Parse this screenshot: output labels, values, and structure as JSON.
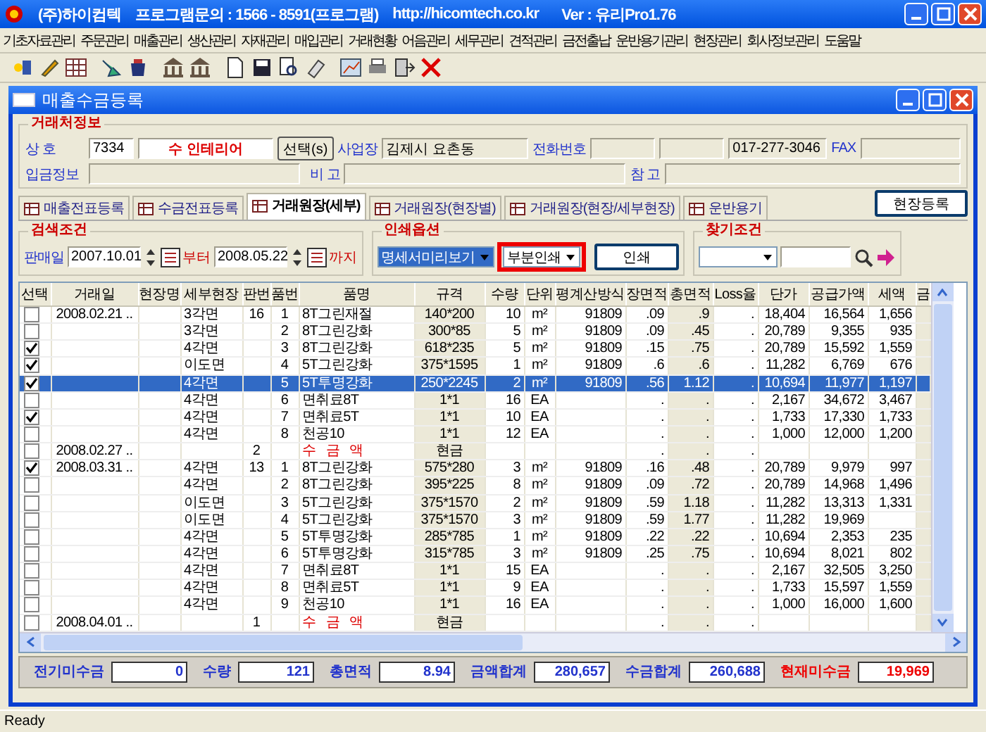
{
  "app": {
    "title": "(주)하이컴텍",
    "contact": "프로그램문의 : 1566 - 8591(프로그램)",
    "url": "http://hicomtech.co.kr",
    "version": "Ver : 유리Pro1.76"
  },
  "menu": [
    "기초자료관리",
    "주문관리",
    "매출관리",
    "생산관리",
    "자재관리",
    "매입관리",
    "거래현황",
    "어음관리",
    "세무관리",
    "견적관리",
    "금전출납",
    "운반용기관리",
    "현장관리",
    "회사정보관리",
    "도움말"
  ],
  "window": {
    "title": "매출수금등록"
  },
  "client_info": {
    "group": "거래처정보",
    "name_label": "상 호",
    "code": "7334",
    "name": "수 인테리어",
    "select_button": "선택(s)",
    "site_label": "사업장",
    "site": "김제시 요촌동",
    "phone_label": "전화번호",
    "phone": "017-277-3046",
    "fax_label": "FAX",
    "deposit_label": "입금정보",
    "memo_label": "비 고",
    "note_label": "참 고"
  },
  "tabs": [
    {
      "label": "매출전표등록",
      "selected": false
    },
    {
      "label": "수금전표등록",
      "selected": false
    },
    {
      "label": "거래원장(세부)",
      "selected": true
    },
    {
      "label": "거래원장(현장별)",
      "selected": false
    },
    {
      "label": "거래원장(현장/세부현장)",
      "selected": false
    },
    {
      "label": "운반용기",
      "selected": false
    }
  ],
  "site_button": "현장등록",
  "search": {
    "group": "검색조건",
    "date_label": "판매일",
    "from": "2007.10.01",
    "from_suffix": "부터",
    "to": "2008.05.22",
    "to_suffix": "까지"
  },
  "print": {
    "group": "인쇄옵션",
    "mode": "명세서미리보기",
    "range": "부분인쇄",
    "button": "인쇄"
  },
  "find": {
    "group": "찾기조건"
  },
  "table": {
    "columns": [
      "선택",
      "거래일",
      "현장명",
      "세부현장",
      "판번",
      "품번",
      "품명",
      "규격",
      "수량",
      "단위",
      "평계산방식",
      "장면적",
      "총면적",
      "Loss율",
      "단가",
      "공급가액",
      "세액",
      "금"
    ],
    "rows": [
      {
        "kind": "item",
        "checked": false,
        "selected": false,
        "cells": [
          null,
          "2008.02.21 ..",
          null,
          "3각면",
          "16",
          "1",
          "8T그린재절",
          "140*200",
          "10",
          "m²",
          "91809",
          ".09",
          ".9",
          ".",
          "18,404",
          "16,564",
          "1,656"
        ]
      },
      {
        "kind": "item",
        "checked": false,
        "selected": false,
        "cells": [
          null,
          null,
          null,
          "3각면",
          null,
          "2",
          "8T그린강화",
          "300*85",
          "5",
          "m²",
          "91809",
          ".09",
          ".45",
          ".",
          "20,789",
          "9,355",
          "935"
        ]
      },
      {
        "kind": "item",
        "checked": true,
        "selected": false,
        "cells": [
          null,
          null,
          null,
          "4각면",
          null,
          "3",
          "8T그린강화",
          "618*235",
          "5",
          "m²",
          "91809",
          ".15",
          ".75",
          ".",
          "20,789",
          "15,592",
          "1,559"
        ]
      },
      {
        "kind": "item",
        "checked": true,
        "selected": false,
        "cells": [
          null,
          null,
          null,
          "이도면",
          null,
          "4",
          "5T그린강화",
          "375*1595",
          "1",
          "m²",
          "91809",
          ".6",
          ".6",
          ".",
          "11,282",
          "6,769",
          "676"
        ]
      },
      {
        "kind": "item",
        "checked": true,
        "selected": true,
        "cells": [
          null,
          null,
          null,
          "4각면",
          null,
          "5",
          "5T투명강화",
          "250*2245",
          "2",
          "m²",
          "91809",
          ".56",
          "1.12",
          ".",
          "10,694",
          "11,977",
          "1,197"
        ]
      },
      {
        "kind": "item",
        "checked": false,
        "selected": false,
        "cells": [
          null,
          null,
          null,
          "4각면",
          null,
          "6",
          "면취료8T",
          "1*1",
          "16",
          "EA",
          null,
          ".",
          ".",
          ".",
          "2,167",
          "34,672",
          "3,467"
        ]
      },
      {
        "kind": "item",
        "checked": true,
        "selected": false,
        "cells": [
          null,
          null,
          null,
          "4각면",
          null,
          "7",
          "면취료5T",
          "1*1",
          "10",
          "EA",
          null,
          ".",
          ".",
          ".",
          "1,733",
          "17,330",
          "1,733"
        ]
      },
      {
        "kind": "item",
        "checked": false,
        "selected": false,
        "cells": [
          null,
          null,
          null,
          "4각면",
          null,
          "8",
          "천공10",
          "1*1",
          "12",
          "EA",
          null,
          ".",
          ".",
          ".",
          "1,000",
          "12,000",
          "1,200"
        ]
      },
      {
        "kind": "payment",
        "checked": false,
        "selected": false,
        "cells": [
          null,
          "2008.02.27 ..",
          null,
          null,
          "2",
          null,
          "수 금 액",
          "현금",
          null,
          null,
          null,
          ".",
          ".",
          ".",
          null,
          null,
          null
        ]
      },
      {
        "kind": "item",
        "checked": true,
        "selected": false,
        "cells": [
          null,
          "2008.03.31 ..",
          null,
          "4각면",
          "13",
          "1",
          "8T그린강화",
          "575*280",
          "3",
          "m²",
          "91809",
          ".16",
          ".48",
          ".",
          "20,789",
          "9,979",
          "997"
        ]
      },
      {
        "kind": "item",
        "checked": false,
        "selected": false,
        "cells": [
          null,
          null,
          null,
          "4각면",
          null,
          "2",
          "8T그린강화",
          "395*225",
          "8",
          "m²",
          "91809",
          ".09",
          ".72",
          ".",
          "20,789",
          "14,968",
          "1,496"
        ]
      },
      {
        "kind": "item",
        "checked": false,
        "selected": false,
        "cells": [
          null,
          null,
          null,
          "이도면",
          null,
          "3",
          "5T그린강화",
          "375*1570",
          "2",
          "m²",
          "91809",
          ".59",
          "1.18",
          ".",
          "11,282",
          "13,313",
          "1,331"
        ]
      },
      {
        "kind": "item",
        "checked": false,
        "selected": false,
        "cells": [
          null,
          null,
          null,
          "이도면",
          null,
          "4",
          "5T그린강화",
          "375*1570",
          "3",
          "m²",
          "91809",
          ".59",
          "1.77",
          ".",
          "11,282",
          "19,969",
          null
        ]
      },
      {
        "kind": "item",
        "checked": false,
        "selected": false,
        "cells": [
          null,
          null,
          null,
          "4각면",
          null,
          "5",
          "5T투명강화",
          "285*785",
          "1",
          "m²",
          "91809",
          ".22",
          ".22",
          ".",
          "10,694",
          "2,353",
          "235"
        ]
      },
      {
        "kind": "item",
        "checked": false,
        "selected": false,
        "cells": [
          null,
          null,
          null,
          "4각면",
          null,
          "6",
          "5T투명강화",
          "315*785",
          "3",
          "m²",
          "91809",
          ".25",
          ".75",
          ".",
          "10,694",
          "8,021",
          "802"
        ]
      },
      {
        "kind": "item",
        "checked": false,
        "selected": false,
        "cells": [
          null,
          null,
          null,
          "4각면",
          null,
          "7",
          "면취료8T",
          "1*1",
          "15",
          "EA",
          null,
          ".",
          ".",
          ".",
          "2,167",
          "32,505",
          "3,250"
        ]
      },
      {
        "kind": "item",
        "checked": false,
        "selected": false,
        "cells": [
          null,
          null,
          null,
          "4각면",
          null,
          "8",
          "면취료5T",
          "1*1",
          "9",
          "EA",
          null,
          ".",
          ".",
          ".",
          "1,733",
          "15,597",
          "1,559"
        ]
      },
      {
        "kind": "item",
        "checked": false,
        "selected": false,
        "cells": [
          null,
          null,
          null,
          "4각면",
          null,
          "9",
          "천공10",
          "1*1",
          "16",
          "EA",
          null,
          ".",
          ".",
          ".",
          "1,000",
          "16,000",
          "1,600"
        ]
      },
      {
        "kind": "payment",
        "checked": false,
        "selected": false,
        "cells": [
          null,
          "2008.04.01 ..",
          null,
          null,
          "1",
          null,
          "수 금 액",
          "현금",
          null,
          null,
          null,
          ".",
          ".",
          ".",
          null,
          null,
          null
        ]
      }
    ]
  },
  "totals": [
    {
      "label": "전기미수금",
      "value": "0",
      "alert": false
    },
    {
      "label": "수량",
      "value": "121",
      "alert": false
    },
    {
      "label": "총면적",
      "value": "8.94",
      "alert": false
    },
    {
      "label": "금액합계",
      "value": "280,657",
      "alert": false
    },
    {
      "label": "수금합계",
      "value": "260,688",
      "alert": false
    },
    {
      "label": "현재미수금",
      "value": "19,969",
      "alert": true
    }
  ],
  "status_bar": "Ready"
}
